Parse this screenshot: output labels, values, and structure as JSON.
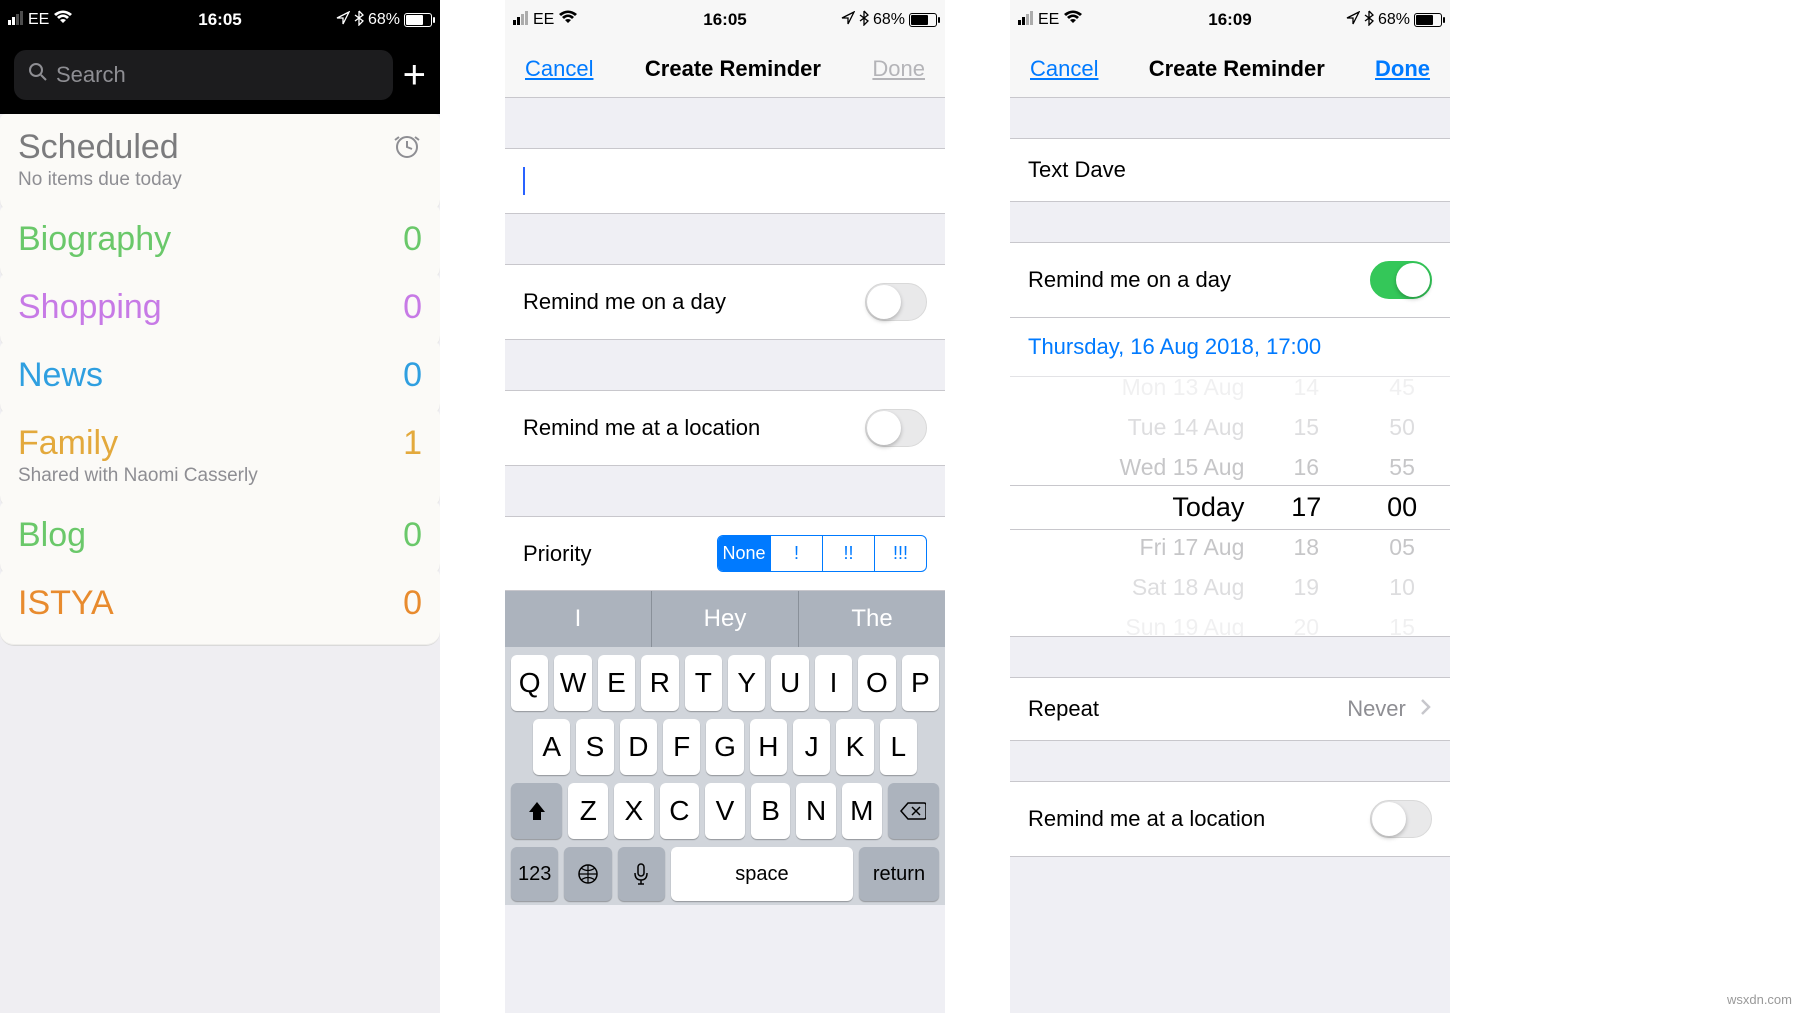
{
  "status": {
    "carrier": "EE",
    "time1": "16:05",
    "time2": "16:05",
    "time3": "16:09",
    "battery_pct": "68%",
    "battery_fill": 68
  },
  "screen1": {
    "search_placeholder": "Search",
    "scheduled_title": "Scheduled",
    "scheduled_sub": "No items due today",
    "lists": [
      {
        "name": "Biography",
        "count": "0",
        "color": "#6ac86a"
      },
      {
        "name": "Shopping",
        "count": "0",
        "color": "#c77ae6"
      },
      {
        "name": "News",
        "count": "0",
        "color": "#2f9fe0"
      },
      {
        "name": "Family",
        "count": "1",
        "color": "#e3a93c",
        "sub": "Shared with Naomi Casserly"
      },
      {
        "name": "Blog",
        "count": "0",
        "color": "#6ac86a"
      },
      {
        "name": "ISTYA",
        "count": "0",
        "color": "#e88b2e"
      }
    ]
  },
  "screen2": {
    "cancel": "Cancel",
    "title": "Create Reminder",
    "done": "Done",
    "remind_day": "Remind me on a day",
    "remind_loc": "Remind me at a location",
    "priority_label": "Priority",
    "priority_opts": [
      "None",
      "!",
      "!!",
      "!!!"
    ],
    "suggestions": [
      "I",
      "Hey",
      "The"
    ],
    "kb_rows": [
      [
        "Q",
        "W",
        "E",
        "R",
        "T",
        "Y",
        "U",
        "I",
        "O",
        "P"
      ],
      [
        "A",
        "S",
        "D",
        "F",
        "G",
        "H",
        "J",
        "K",
        "L"
      ],
      [
        "Z",
        "X",
        "C",
        "V",
        "B",
        "N",
        "M"
      ]
    ],
    "key_123": "123",
    "key_space": "space",
    "key_return": "return"
  },
  "screen3": {
    "cancel": "Cancel",
    "title": "Create Reminder",
    "done": "Done",
    "note": "Text Dave",
    "remind_day": "Remind me on a day",
    "date_text": "Thursday, 16 Aug 2018, 17:00",
    "picker": {
      "dates": [
        "Mon 13 Aug",
        "Tue 14 Aug",
        "Wed 15 Aug",
        "Today",
        "Fri 17 Aug",
        "Sat 18 Aug",
        "Sun 19 Aug"
      ],
      "hours": [
        "14",
        "15",
        "16",
        "17",
        "18",
        "19",
        "20"
      ],
      "mins": [
        "45",
        "50",
        "55",
        "00",
        "05",
        "10",
        "15"
      ]
    },
    "repeat_label": "Repeat",
    "repeat_value": "Never",
    "remind_loc": "Remind me at a location"
  },
  "watermark": "wsxdn.com"
}
